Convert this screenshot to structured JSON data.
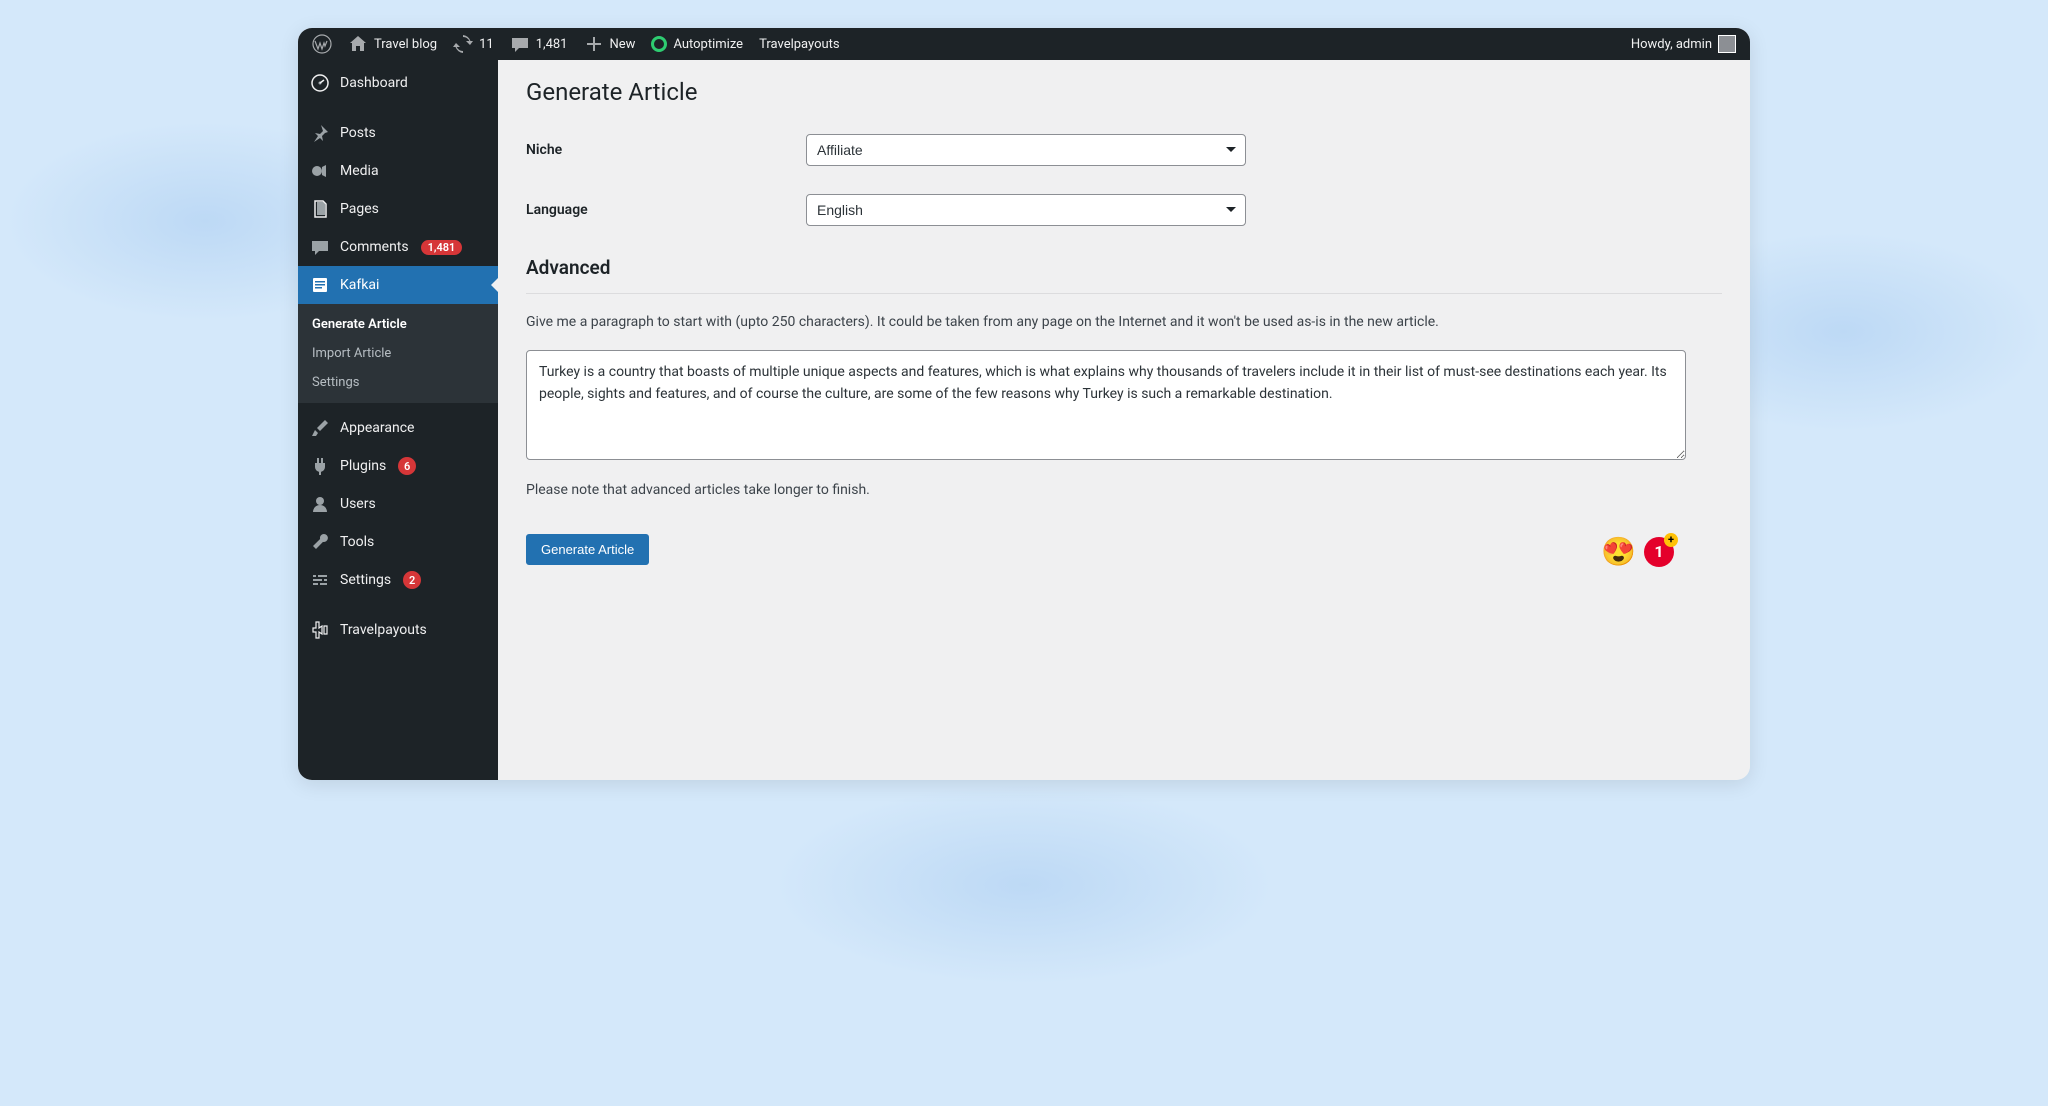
{
  "adminbar": {
    "site_name": "Travel blog",
    "updates_count": "11",
    "comments_count": "1,481",
    "new_label": "New",
    "autoptimize_label": "Autoptimize",
    "travelpayouts_label": "Travelpayouts",
    "howdy": "Howdy, admin"
  },
  "sidebar": {
    "dashboard": "Dashboard",
    "posts": "Posts",
    "media": "Media",
    "pages": "Pages",
    "comments": "Comments",
    "comments_badge": "1,481",
    "kafkai": "Kafkai",
    "kafkai_sub": {
      "generate": "Generate Article",
      "import": "Import Article",
      "settings": "Settings"
    },
    "appearance": "Appearance",
    "plugins": "Plugins",
    "plugins_badge": "6",
    "users": "Users",
    "tools": "Tools",
    "settings": "Settings",
    "settings_badge": "2",
    "travelpayouts": "Travelpayouts"
  },
  "page": {
    "title": "Generate Article",
    "niche_label": "Niche",
    "niche_value": "Affiliate",
    "language_label": "Language",
    "language_value": "English",
    "advanced_heading": "Advanced",
    "advanced_help": "Give me a paragraph to start with (upto 250 characters). It could be taken from any page on the Internet and it won't be used as-is in the new article.",
    "textarea_value": "Turkey is a country that boasts of multiple unique aspects and features, which is what explains why thousands of travelers include it in their list of must-see destinations each year. Its people, sights and features, and of course the culture, are some of the few reasons why Turkey is such a remarkable destination.",
    "note": "Please note that advanced articles take longer to finish.",
    "button": "Generate Article"
  },
  "floating": {
    "count": "1"
  }
}
